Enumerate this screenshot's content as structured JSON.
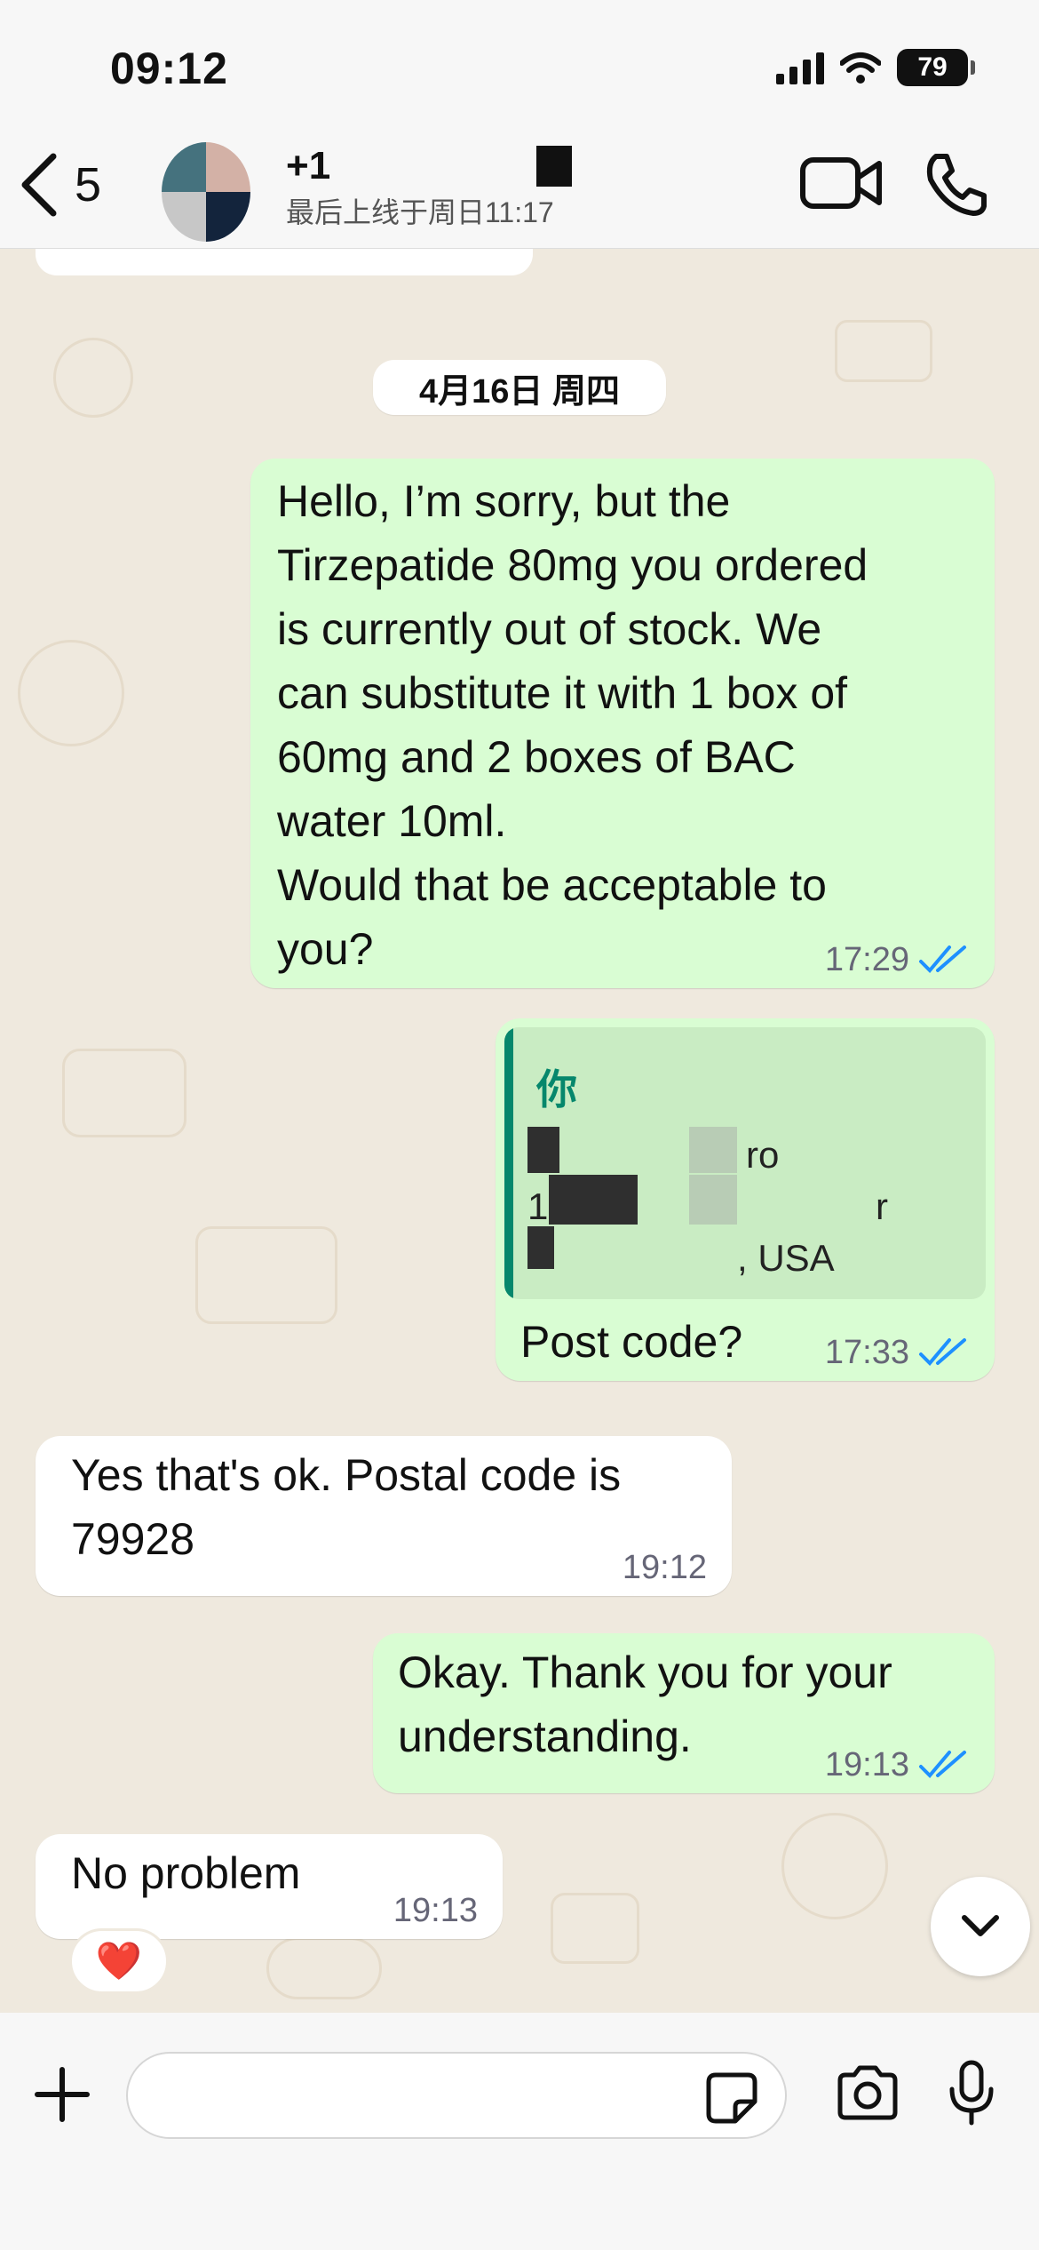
{
  "status_bar": {
    "time": "09:12",
    "battery": "79"
  },
  "header": {
    "back_count": "5",
    "contact_name": "+1",
    "last_seen": "最后上线于周日11:17"
  },
  "chat": {
    "date_separator": "4月16日 周四",
    "messages": [
      {
        "direction": "outgoing",
        "text": "Hello, I’m sorry, but the\nTirzepatide 80mg you ordered\nis currently out of stock. We\ncan substitute it with 1 box of\n60mg and 2 boxes of BAC\nwater 10ml.\nWould that be acceptable to\nyou?",
        "time": "17:29",
        "status": "read"
      },
      {
        "direction": "outgoing",
        "quote": {
          "author": "你",
          "line1": "ro",
          "line2_prefix": "1",
          "line2_suffix": "r",
          "line3": ", USA"
        },
        "text": "Post code?",
        "time": "17:33",
        "status": "read"
      },
      {
        "direction": "incoming",
        "text": "Yes that's ok. Postal code is\n79928",
        "time": "19:12"
      },
      {
        "direction": "outgoing",
        "text": "Okay. Thank you for your\nunderstanding.",
        "time": "19:13",
        "status": "read"
      },
      {
        "direction": "incoming",
        "text": "No problem",
        "time": "19:13",
        "reaction": "❤️"
      }
    ]
  },
  "input": {
    "value": ""
  },
  "colors": {
    "outgoing_bubble": "#d9fdd3",
    "incoming_bubble": "#ffffff",
    "read_ticks": "#1e90ff",
    "quote_accent": "#06876c",
    "chat_background": "#efe9de"
  },
  "icons": {
    "back": "chevron-left-icon",
    "video": "video-camera-icon",
    "call": "phone-icon",
    "read": "double-check-icon",
    "scroll": "chevron-down-icon",
    "attach": "plus-icon",
    "sticker": "sticker-icon",
    "camera": "camera-icon",
    "mic": "microphone-icon"
  }
}
